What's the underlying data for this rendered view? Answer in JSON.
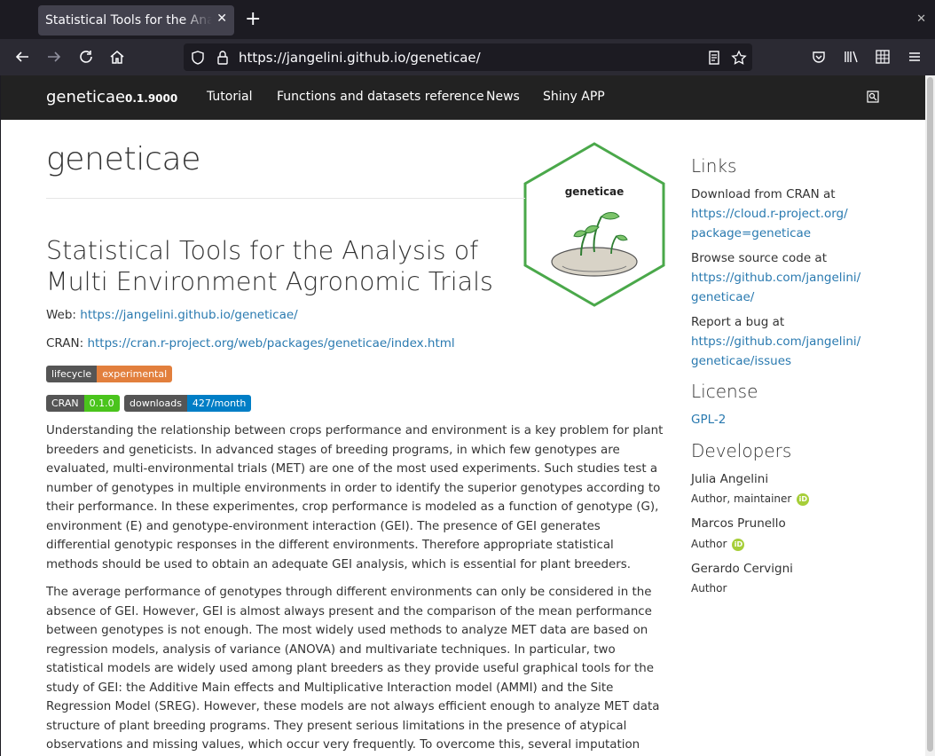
{
  "browser": {
    "tab_title": "Statistical Tools for the Analysis of Multi",
    "url": "https://jangelini.github.io/geneticae/"
  },
  "navbar": {
    "brand": "geneticae",
    "version": "0.1.9000",
    "links": [
      "Tutorial",
      "Functions and datasets reference",
      "News",
      "Shiny APP"
    ]
  },
  "main": {
    "title": "geneticae",
    "subtitle": "Statistical Tools for the Analysis of Multi Environment Agronomic Trials",
    "web_label": "Web:",
    "web_url": "https://jangelini.github.io/geneticae/",
    "cran_label": "CRAN:",
    "cran_url": "https://cran.r-project.org/web/packages/geneticae/index.html",
    "badges": {
      "lifecycle": {
        "left": "lifecycle",
        "right": "experimental",
        "color": "#e27f3d"
      },
      "cran": {
        "left": "CRAN",
        "right": "0.1.0",
        "color": "#4ac41c"
      },
      "downloads": {
        "left": "downloads",
        "right": "427/month",
        "color": "#007ec6"
      }
    },
    "paragraph1": "Understanding the relationship between crops performance and environment is a key problem for plant breeders and geneticists. In advanced stages of breeding programs, in which few genotypes are evaluated, multi-environmental trials (MET) are one of the most used experiments. Such studies test a number of genotypes in multiple environments in order to identify the superior genotypes according to their performance. In these experimentes, crop performance is modeled as a function of genotype (G), environment (E) and genotype-environment interaction (GEI). The presence of GEI generates differential genotypic responses in the different environments. Therefore appropriate statistical methods should be used to obtain an adequate GEI analysis, which is essential for plant breeders.",
    "paragraph2": "The average performance of genotypes through different environments can only be considered in the absence of GEI. However, GEI is almost always present and the comparison of the mean performance between genotypes is not enough. The most widely used methods to analyze MET data are based on regression models, analysis of variance (ANOVA) and multivariate techniques. In particular, two statistical models are widely used among plant breeders as they provide useful graphical tools for the study of GEI: the Additive Main effects and Multiplicative Interaction model (AMMI) and the Site Regression Model (SREG). However, these models are not always efficient enough to analyze MET data structure of plant breeding programs. They present serious limitations in the presence of atypical observations and missing values, which occur very frequently. To overcome this, several imputation alternatives and a robust AMMI were recently proposed in literature.",
    "logo_text": "geneticae"
  },
  "sidebar": {
    "links_heading": "Links",
    "cran_text": "Download from CRAN at",
    "cran_link_1": "https://cloud.r-project.org/",
    "cran_link_2": "package=geneticae",
    "source_text": "Browse source code at",
    "source_link_1": "https://github.com/jangelini/",
    "source_link_2": "geneticae/",
    "bug_text": "Report a bug at",
    "bug_link_1": "https://github.com/jangelini/",
    "bug_link_2": "geneticae/issues",
    "license_heading": "License",
    "license": "GPL-2",
    "developers_heading": "Developers",
    "developers": [
      {
        "name": "Julia Angelini",
        "role": "Author, maintainer"
      },
      {
        "name": "Marcos Prunello",
        "role": "Author"
      },
      {
        "name": "Gerardo Cervigni",
        "role": "Author"
      }
    ],
    "orcid_label": "iD"
  },
  "icons": [
    "back-icon",
    "forward-icon",
    "reload-icon",
    "home-icon",
    "shield-icon",
    "lock-icon",
    "reader-icon",
    "bookmark-star-icon",
    "pocket-icon",
    "library-icon",
    "extensions-icon",
    "menu-icon",
    "search-icon",
    "orcid-icon"
  ]
}
